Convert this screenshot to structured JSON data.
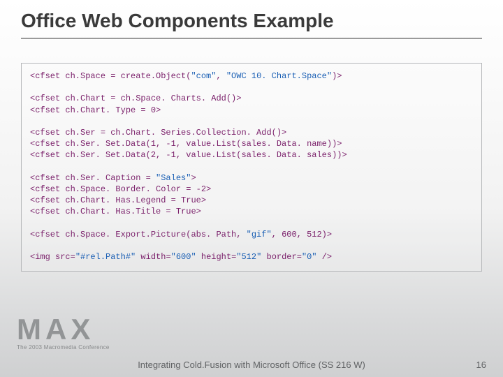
{
  "title": "Office Web Components Example",
  "code": {
    "l01a": "<cfset ch.Space = create.Object(",
    "l01s1": "\"com\"",
    "l01b": ", ",
    "l01s2": "\"OWC 10. Chart.Space\"",
    "l01c": ")>",
    "l02": "<cfset ch.Chart = ch.Space. Charts. Add()>",
    "l03": "<cfset ch.Chart. Type = 0>",
    "l04": "<cfset ch.Ser = ch.Chart. Series.Collection. Add()>",
    "l05": "<cfset ch.Ser. Set.Data(1, -1, value.List(sales. Data. name))>",
    "l06": "<cfset ch.Ser. Set.Data(2, -1, value.List(sales. Data. sales))>",
    "l07a": "<cfset ch.Ser. Caption = ",
    "l07s": "\"Sales\"",
    "l07b": ">",
    "l08": "<cfset ch.Space. Border. Color = -2>",
    "l09": "<cfset ch.Chart. Has.Legend = True>",
    "l10": "<cfset ch.Chart. Has.Title = True>",
    "l11a": "<cfset ch.Space. Export.Picture(abs. Path, ",
    "l11s": "\"gif\"",
    "l11b": ", 600, 512)>",
    "l12_pre": "<img src=",
    "l12_src": "\"#rel.Path#\"",
    "l12_a": " width=",
    "l12_w": "\"600\"",
    "l12_b": " height=",
    "l12_h": "\"512\"",
    "l12_c": " border=",
    "l12_bd": "\"0\"",
    "l12_end": " />"
  },
  "footer": {
    "logo_main": "MAX",
    "logo_sub": "The 2003 Macromedia Conference",
    "title": "Integrating Cold.Fusion with Microsoft Office (SS 216 W)",
    "page": "16"
  }
}
